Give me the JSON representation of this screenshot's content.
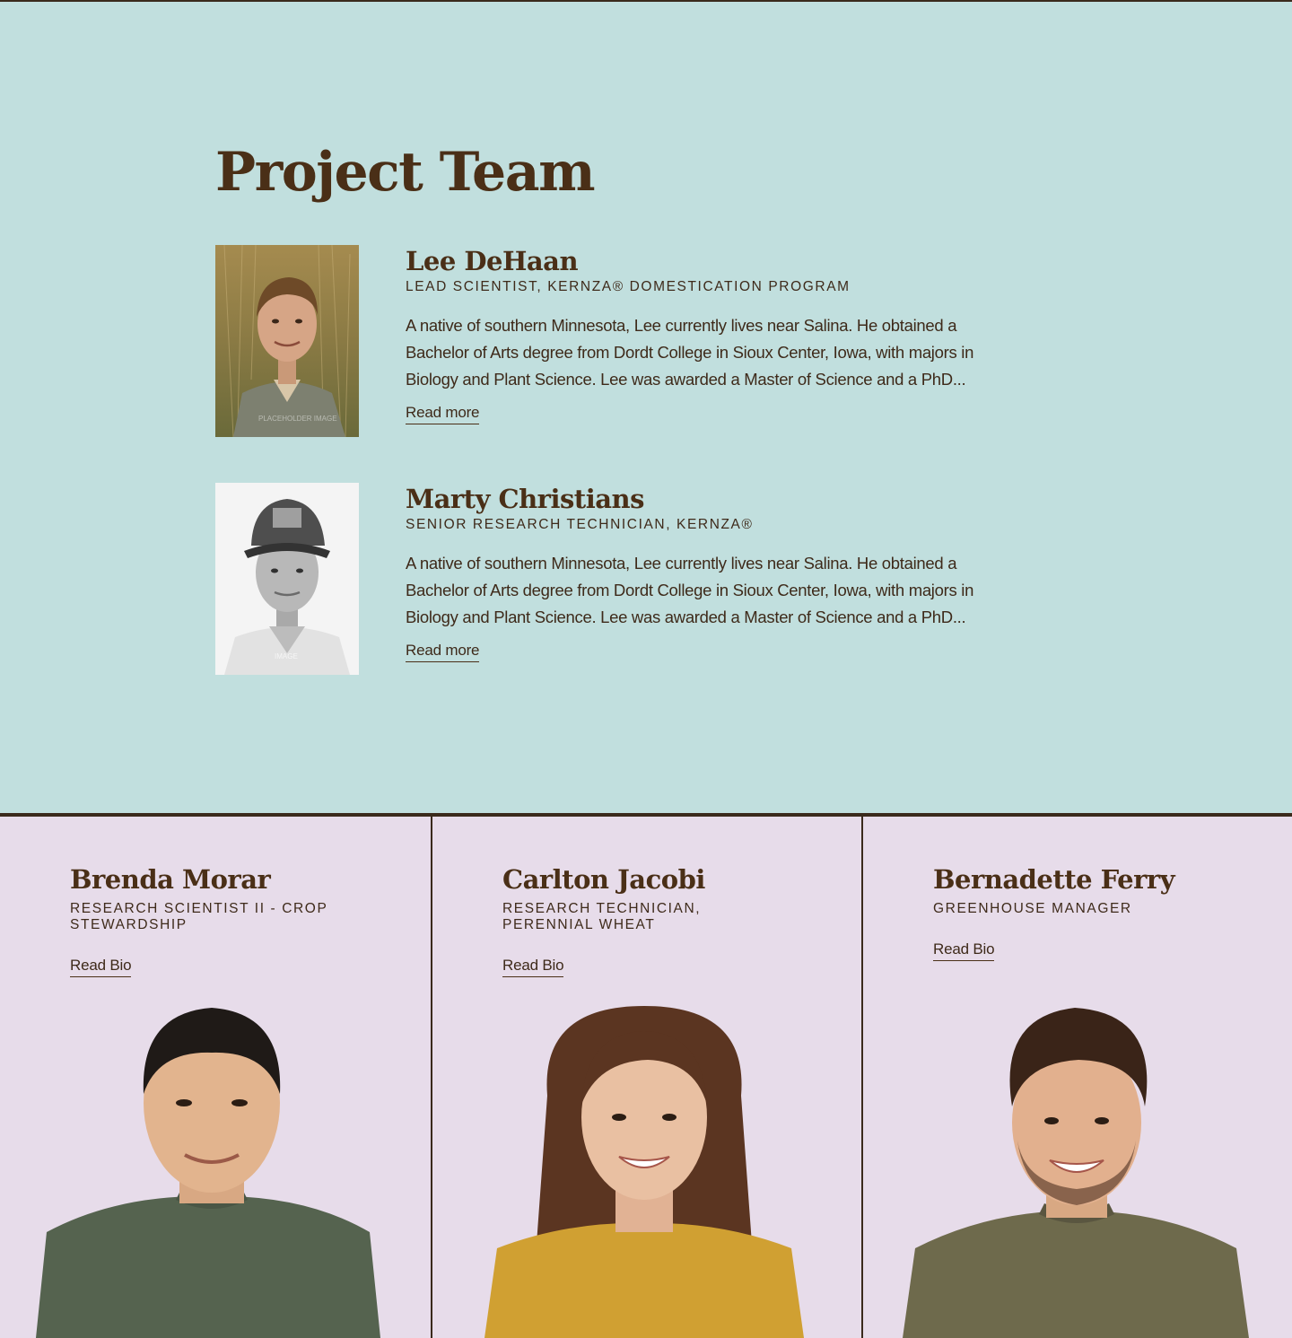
{
  "section": {
    "title": "Project Team"
  },
  "featured": [
    {
      "name": "Lee DeHaan",
      "role": "LEAD SCIENTIST, KERNZA® DOMESTICATION PROGRAM",
      "bio": "A native of southern Minnesota, Lee currently lives near Salina. He obtained a Bachelor of Arts degree from Dordt College in Sioux Center, Iowa, with majors in Biology and Plant Science. Lee was awarded a Master of Science and a PhD...",
      "link": "Read more",
      "photo_watermark": "PLACEHOLDER IMAGE"
    },
    {
      "name": "Marty Christians",
      "role": "SENIOR RESEARCH TECHNICIAN, KERNZA®",
      "bio": "A native of southern Minnesota, Lee currently lives near Salina. He obtained a Bachelor of Arts degree from Dordt College in Sioux Center, Iowa, with majors in Biology and Plant Science. Lee was awarded a Master of Science and a PhD...",
      "link": "Read more",
      "photo_watermark": "IMAGE"
    }
  ],
  "cards": [
    {
      "name": "Brenda Morar",
      "role": "RESEARCH SCIENTIST II - CROP STEWARDSHIP",
      "link": "Read Bio",
      "sweater_color": "#55634f"
    },
    {
      "name": "Carlton Jacobi",
      "role": "RESEARCH TECHNICIAN, PERENNIAL WHEAT",
      "link": "Read Bio",
      "sweater_color": "#d0a032"
    },
    {
      "name": "Bernadette Ferry",
      "role": "GREENHOUSE MANAGER",
      "link": "Read Bio",
      "sweater_color": "#6e6a4c"
    }
  ],
  "colors": {
    "top_bg": "#c1dfde",
    "bottom_bg": "#e7dcea",
    "text": "#4a2f17",
    "rule": "#3a2a1c"
  }
}
